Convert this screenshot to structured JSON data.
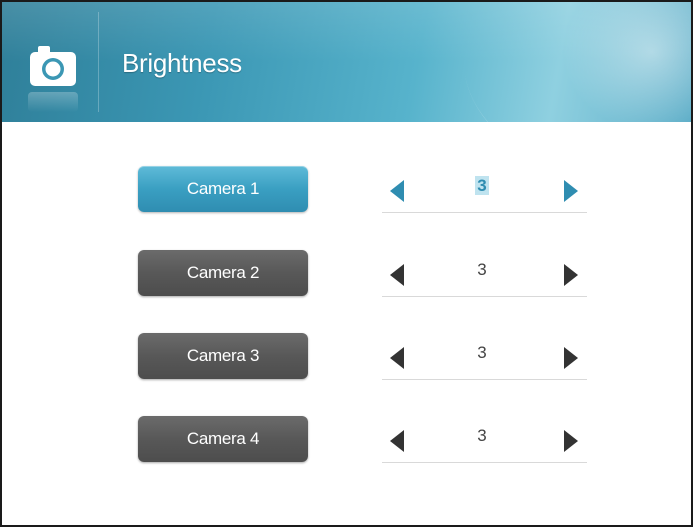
{
  "header": {
    "title": "Brightness",
    "icon": "camera-icon"
  },
  "colors": {
    "accent": "#3a9fc2",
    "button_inactive": "#585858",
    "arrow_active": "#2f8db1",
    "arrow_inactive": "#333333"
  },
  "cameras": [
    {
      "label": "Camera 1",
      "value": "3",
      "selected": true
    },
    {
      "label": "Camera 2",
      "value": "3",
      "selected": false
    },
    {
      "label": "Camera 3",
      "value": "3",
      "selected": false
    },
    {
      "label": "Camera 4",
      "value": "3",
      "selected": false
    }
  ]
}
